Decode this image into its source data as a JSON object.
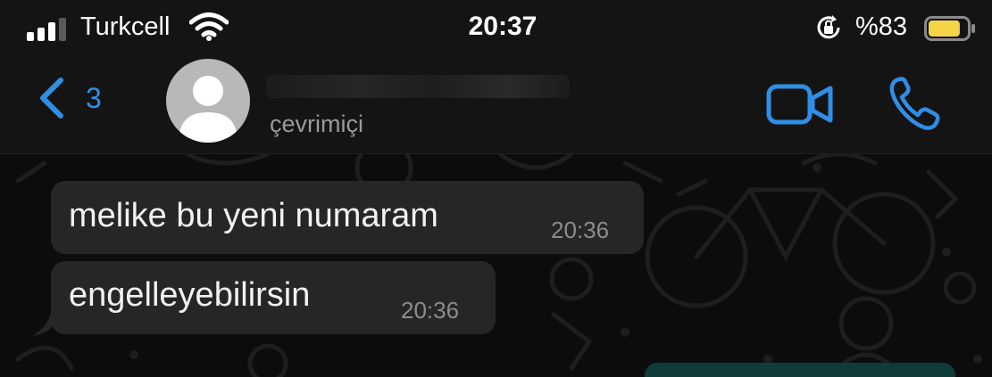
{
  "status_bar": {
    "carrier": "Turkcell",
    "time": "20:37",
    "battery_percent": "%83",
    "battery_level": 0.83,
    "battery_color": "#f5d547"
  },
  "header": {
    "back_count": "3",
    "contact_name": "",
    "presence": "çevrimiçi",
    "accent_color": "#2f8fe6"
  },
  "messages": [
    {
      "text": "melike bu yeni numaram",
      "time": "20:36"
    },
    {
      "text": "engelleyebilirsin",
      "time": "20:36"
    }
  ],
  "icons": [
    "signal-icon",
    "wifi-icon",
    "orientation-lock-icon",
    "battery-icon",
    "chevron-left-icon",
    "avatar-placeholder-icon",
    "video-camera-icon",
    "phone-icon"
  ]
}
